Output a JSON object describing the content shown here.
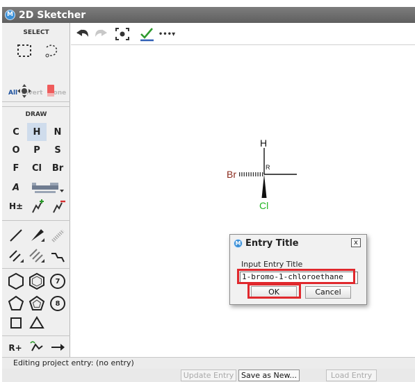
{
  "app": {
    "logo_glyph": "M",
    "title": "2D Sketcher"
  },
  "sidebar": {
    "select_label": "SELECT",
    "select_modes": [
      "All",
      "Invert",
      "None"
    ],
    "draw_label": "DRAW",
    "elements": [
      "C",
      "H",
      "N",
      "O",
      "P",
      "S",
      "F",
      "Cl",
      "Br"
    ],
    "selected_element": "H",
    "misc": {
      "atom_label": "A",
      "charge_label": "H±",
      "rgroup_label": "R+"
    },
    "ring_sizes": [
      "7",
      "8"
    ]
  },
  "toolbar": {
    "more_glyph": "•••▾"
  },
  "molecule": {
    "atoms": {
      "top": "H",
      "left": "Br",
      "bottom": "Cl"
    },
    "stereo_label": "R"
  },
  "dialog": {
    "logo_glyph": "M",
    "title": "Entry Title",
    "close_glyph": "x",
    "input_label": "Input Entry Title",
    "input_value": "1-bromo-1-chloroethane",
    "ok_label": "OK",
    "cancel_label": "Cancel"
  },
  "status": {
    "text": "Editing project entry: (no entry)"
  },
  "bottom": {
    "update_label": "Update Entry",
    "save_new_label": "Save as New...",
    "load_label": "Load Entry"
  },
  "colors": {
    "highlight": "#e0282d",
    "bromine": "#8b2b1d",
    "chlorine": "#1fb41f",
    "accent_check": "#2f9a2f"
  }
}
